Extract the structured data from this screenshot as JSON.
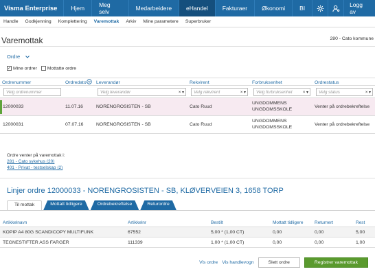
{
  "app": {
    "brand": "Visma Enterprise"
  },
  "topnav": {
    "items": [
      "Hjem",
      "Meg selv",
      "Medarbeidere",
      "eHandel",
      "Fakturaer",
      "Økonomi",
      "BI"
    ],
    "logout": "Logg av"
  },
  "subnav": {
    "items": [
      "Handle",
      "Godkjenning",
      "Komplettering",
      "Varemottak",
      "Arkiv",
      "Mine parametere",
      "Superbruker"
    ]
  },
  "page": {
    "title": "Varemottak",
    "company": "280 - Cato kommune"
  },
  "orders_dropdown": "Ordre",
  "filters": {
    "mine_ordrer": "Mine ordrer",
    "mottatte_ordrer": "Mottatte ordre"
  },
  "orders_table": {
    "columns": [
      "Ordrenummer",
      "Ordredato",
      "Leverandør",
      "Rekvirent",
      "Forbruksenhet",
      "Ordrestatus"
    ],
    "placeholders": [
      "Velg ordrenummer",
      "Velg leverandør",
      "Velg rekvirent",
      "Velg forbruksenhet",
      "Velg status"
    ],
    "rows": [
      {
        "nr": "12000033",
        "dato": "11.07.16",
        "leverandor": "NORENGROSISTEN - SB",
        "rekvirent": "Cato Ruud",
        "enhet1": "UNGDOMMENS",
        "enhet2": "UNGDOMSSKOLE",
        "status": "Venter på ordrebekreftelse"
      },
      {
        "nr": "12000031",
        "dato": "07.07.16",
        "leverandor": "NORENGROSISTEN - SB",
        "rekvirent": "Cato Ruud",
        "enhet1": "UNGDOMMENS",
        "enhet2": "UNGDOMSSKOLE",
        "status": "Venter på ordrebekreftelse"
      }
    ]
  },
  "pending": {
    "title": "Ordre venter på varemottak i:",
    "links": [
      "281 - Cato sykehus (20)",
      "401 - Privat - testselskap (2)"
    ]
  },
  "lines": {
    "title": "Linjer ordre 12000033 - NORENGROSISTEN - SB, KLØVERVEIEN 3, 1658 TORP",
    "tabs": [
      "Til mottak",
      "Mottatt tidligere",
      "Ordrebekreftelse",
      "Returordre"
    ],
    "columns": [
      "Artikkelnavn",
      "Artikkelnr",
      "Bestilt",
      "Mottatt tidligere",
      "Returnert",
      "Rest"
    ],
    "rows": [
      {
        "navn": "KOPIP A4 80G SCANDICOPY MULTIFUNK",
        "nr": "67552",
        "bestilt": "5,00 * (1,00 CT)",
        "mottatt": "0,00",
        "returnert": "0,00",
        "rest": "5,00"
      },
      {
        "navn": "TEGNESTIFTER ASS FARGER",
        "nr": "111339",
        "bestilt": "1,00 * (1,00 CT)",
        "mottatt": "0,00",
        "returnert": "0,00",
        "rest": "1,00"
      }
    ]
  },
  "footer": {
    "vis_ordre": "Vis ordre",
    "vis_handlevogn": "Vis handlevogn",
    "slett": "Slett ordre",
    "registrer": "Registrer varemottak"
  },
  "colors": {
    "nav": "#1f6aa4",
    "nav_active": "#154f7d",
    "link": "#1f6aa4",
    "primary_button": "#5a9a2e",
    "selected_row": "#f7eaf1"
  }
}
